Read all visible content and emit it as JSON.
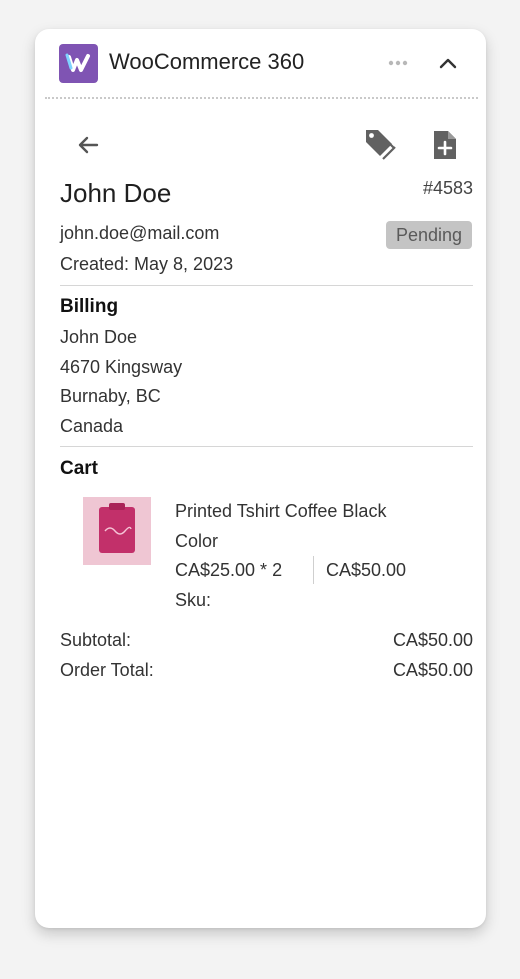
{
  "app": {
    "title": "WooCommerce 360"
  },
  "order": {
    "customer_name": "John Doe",
    "number": "#4583",
    "email": "john.doe@mail.com",
    "status": "Pending",
    "created": "Created: May 8, 2023"
  },
  "billing": {
    "title": "Billing",
    "name": "John Doe",
    "street": "4670 Kingsway",
    "city": "Burnaby, BC",
    "country": "Canada"
  },
  "cart": {
    "title": "Cart",
    "items": [
      {
        "name_line1": "Printed Tshirt Coffee Black",
        "name_line2": "Color",
        "unit_qty": "CA$25.00 * 2",
        "line_total": "CA$50.00",
        "sku": "Sku:"
      }
    ]
  },
  "totals": {
    "subtotal_label": "Subtotal:",
    "subtotal_value": "CA$50.00",
    "order_total_label": "Order Total:",
    "order_total_value": "CA$50.00"
  },
  "icons": {
    "logo": "woocommerce-360-logo",
    "menu": "more-dots-icon",
    "collapse": "chevron-up-icon",
    "back": "arrow-left-icon",
    "tag": "tag-icon",
    "note": "add-note-icon"
  },
  "colors": {
    "brand": "#7f54b3",
    "status_badge": "#c4c4c4",
    "product_bg": "#efc6d3"
  }
}
